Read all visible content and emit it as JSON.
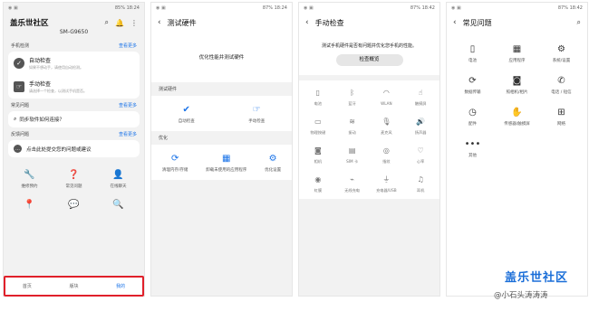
{
  "status": {
    "p1": "85% 18:24",
    "p2": "87% 18:24",
    "p3": "87% 18:42",
    "p4": "87% 18:42"
  },
  "screen1": {
    "title": "盖乐世社区",
    "model": "SM-G9650",
    "check_section": {
      "label": "手机检测",
      "more": "查看更多"
    },
    "auto_check": {
      "title": "自动检查",
      "desc": "如果不想动手，请使用自动检测。"
    },
    "manual_check": {
      "title": "手动检查",
      "desc": "请选择一个检查，以测试手机是否。"
    },
    "faq_section": {
      "label": "常见问题",
      "more": "查看更多"
    },
    "faq_item": "同步软件如何连接？",
    "feedback_section": {
      "label": "反馈问题",
      "more": "查看更多"
    },
    "feedback_item": "点击此处提交您的问题或建议",
    "services": [
      {
        "icon": "wrench-icon",
        "label": "维修预约"
      },
      {
        "icon": "question-icon",
        "label": "常见问题"
      },
      {
        "icon": "person-icon",
        "label": "在线聊天"
      },
      {
        "icon": "pin-icon",
        "label": ""
      },
      {
        "icon": "chat-icon",
        "label": ""
      },
      {
        "icon": "search-icon",
        "label": ""
      }
    ],
    "tabs": [
      "首页",
      "版块",
      "我的"
    ]
  },
  "screen2": {
    "title": "测试硬件",
    "hero": "优化性能并测试硬件",
    "hardware_label": "测试硬件",
    "auto": "自动检查",
    "manual": "手动检查",
    "optimize_label": "优化",
    "opt_items": [
      "清理内存/存储",
      "卸载未使用的应用程序",
      "优化设置"
    ]
  },
  "screen3": {
    "title": "手动检查",
    "desc": "测试手机硬件是否有问题并优化您手机的性能。",
    "button": "检查概览",
    "items": [
      {
        "icon": "battery-icon",
        "label": "电池"
      },
      {
        "icon": "bluetooth-icon",
        "label": "蓝牙"
      },
      {
        "icon": "wifi-icon",
        "label": "WLAN"
      },
      {
        "icon": "touch-icon",
        "label": "触摸屏"
      },
      {
        "icon": "button-icon",
        "label": "物理按键"
      },
      {
        "icon": "vibrate-icon",
        "label": "振动"
      },
      {
        "icon": "mic-icon",
        "label": "麦克风"
      },
      {
        "icon": "speaker-icon",
        "label": "扬声器"
      },
      {
        "icon": "camera-icon",
        "label": "相机"
      },
      {
        "icon": "sim-icon",
        "label": "SIM 卡"
      },
      {
        "icon": "fingerprint-icon",
        "label": "指纹"
      },
      {
        "icon": "heart-icon",
        "label": "心率"
      },
      {
        "icon": "iris-icon",
        "label": "虹膜"
      },
      {
        "icon": "wireless-charge-icon",
        "label": "无线充电"
      },
      {
        "icon": "usb-icon",
        "label": "充电器/USB"
      },
      {
        "icon": "earphone-icon",
        "label": "耳机"
      }
    ]
  },
  "screen4": {
    "title": "常见问题",
    "items": [
      {
        "icon": "battery-icon",
        "label": "电池"
      },
      {
        "icon": "apps-icon",
        "label": "应用程序"
      },
      {
        "icon": "settings-icon",
        "label": "系统/设置"
      },
      {
        "icon": "sync-icon",
        "label": "数据传输"
      },
      {
        "icon": "camera-icon",
        "label": "照相机/相片"
      },
      {
        "icon": "phone-icon",
        "label": "电话 / 短信"
      },
      {
        "icon": "watch-icon",
        "label": "配件"
      },
      {
        "icon": "sensor-icon",
        "label": "传感器/触摸屏"
      },
      {
        "icon": "network-icon",
        "label": "网络"
      },
      {
        "icon": "more-icon",
        "label": "其他"
      }
    ]
  },
  "watermark": {
    "brand": "盖乐世社区",
    "author": "@小石头涛涛涛"
  }
}
